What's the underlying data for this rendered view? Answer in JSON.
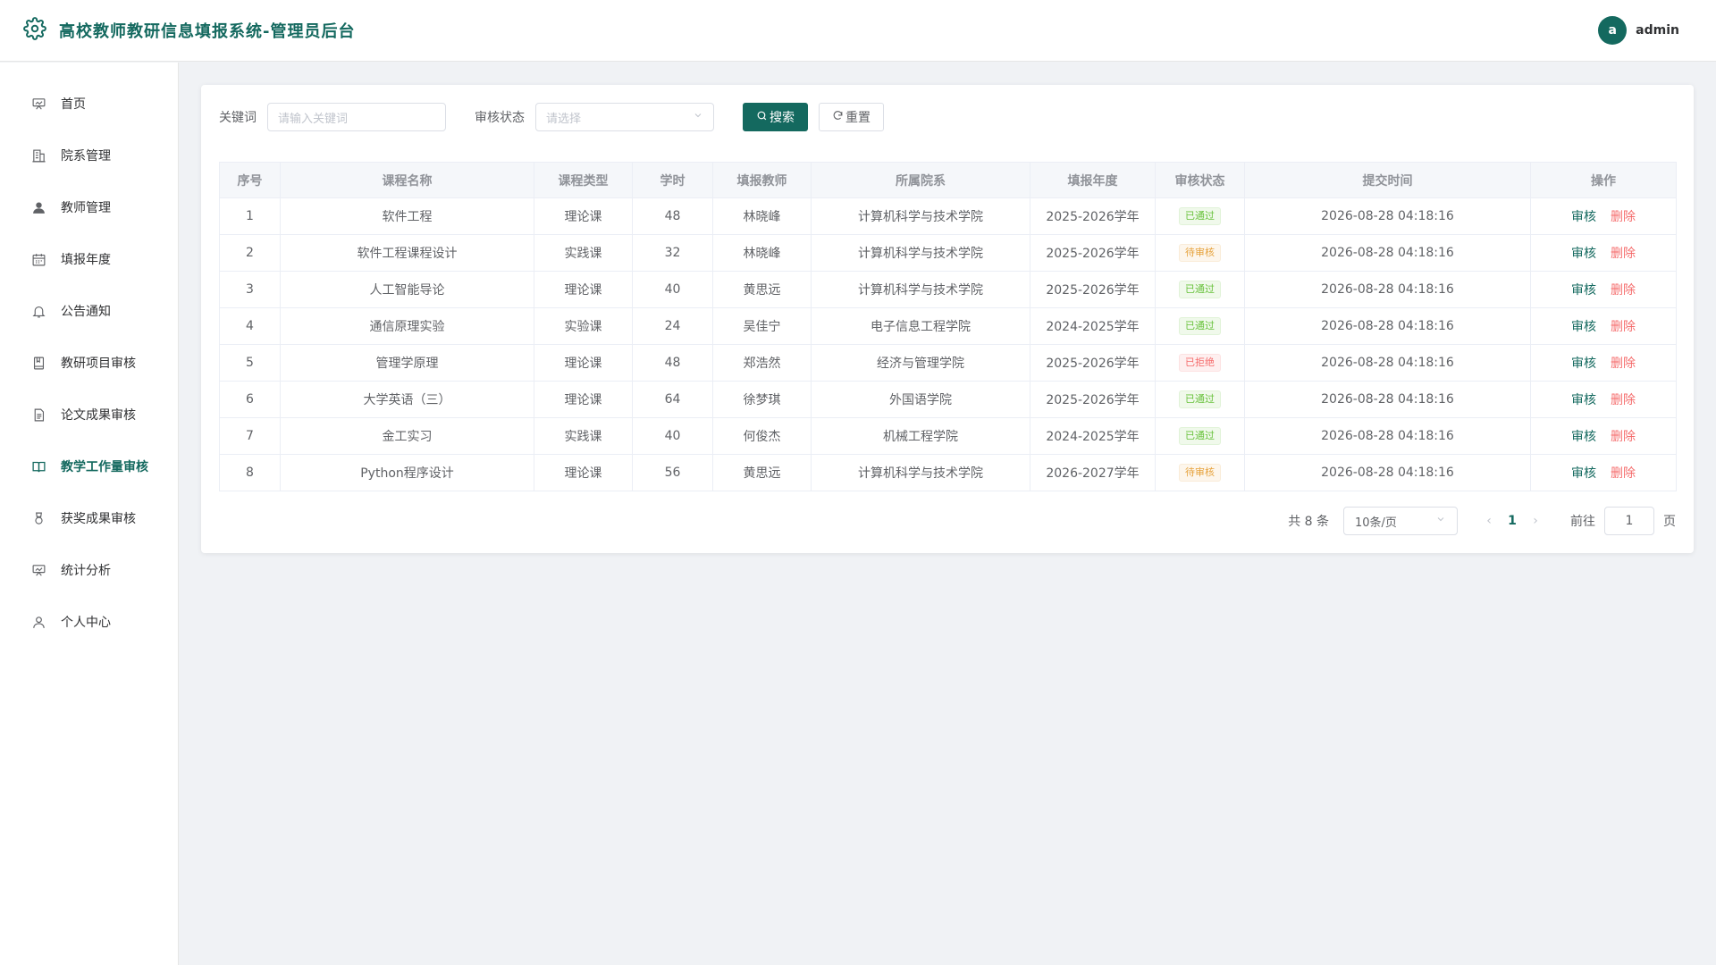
{
  "header": {
    "title": "高校教师教研信息填报系统-管理员后台",
    "avatar_letter": "a",
    "username": "admin",
    "accent": "#14695f"
  },
  "sidebar": {
    "items": [
      {
        "label": "首页",
        "icon": "home-icon"
      },
      {
        "label": "院系管理",
        "icon": "building-icon"
      },
      {
        "label": "教师管理",
        "icon": "user-icon"
      },
      {
        "label": "填报年度",
        "icon": "calendar-icon"
      },
      {
        "label": "公告通知",
        "icon": "bell-icon"
      },
      {
        "label": "教研项目审核",
        "icon": "notebook-icon"
      },
      {
        "label": "论文成果审核",
        "icon": "document-icon"
      },
      {
        "label": "教学工作量审核",
        "icon": "book-icon",
        "active": true
      },
      {
        "label": "获奖成果审核",
        "icon": "medal-icon"
      },
      {
        "label": "统计分析",
        "icon": "chart-icon"
      },
      {
        "label": "个人中心",
        "icon": "person-icon"
      }
    ]
  },
  "filter": {
    "keyword_label": "关键词",
    "keyword_placeholder": "请输入关键词",
    "status_label": "审核状态",
    "status_placeholder": "请选择",
    "search_label": "搜索",
    "reset_label": "重置"
  },
  "table": {
    "columns": [
      "序号",
      "课程名称",
      "课程类型",
      "学时",
      "填报教师",
      "所属院系",
      "填报年度",
      "审核状态",
      "提交时间",
      "操作"
    ],
    "rows": [
      {
        "no": "1",
        "course": "软件工程",
        "type": "理论课",
        "hours": "48",
        "teacher": "林晓峰",
        "dept": "计算机科学与技术学院",
        "year": "2025-2026学年",
        "status": "已通过",
        "status_type": "success",
        "time": "2026-08-28 04:18:16"
      },
      {
        "no": "2",
        "course": "软件工程课程设计",
        "type": "实践课",
        "hours": "32",
        "teacher": "林晓峰",
        "dept": "计算机科学与技术学院",
        "year": "2025-2026学年",
        "status": "待审核",
        "status_type": "warning",
        "time": "2026-08-28 04:18:16"
      },
      {
        "no": "3",
        "course": "人工智能导论",
        "type": "理论课",
        "hours": "40",
        "teacher": "黄思远",
        "dept": "计算机科学与技术学院",
        "year": "2025-2026学年",
        "status": "已通过",
        "status_type": "success",
        "time": "2026-08-28 04:18:16"
      },
      {
        "no": "4",
        "course": "通信原理实验",
        "type": "实验课",
        "hours": "24",
        "teacher": "吴佳宁",
        "dept": "电子信息工程学院",
        "year": "2024-2025学年",
        "status": "已通过",
        "status_type": "success",
        "time": "2026-08-28 04:18:16"
      },
      {
        "no": "5",
        "course": "管理学原理",
        "type": "理论课",
        "hours": "48",
        "teacher": "郑浩然",
        "dept": "经济与管理学院",
        "year": "2025-2026学年",
        "status": "已拒绝",
        "status_type": "danger",
        "time": "2026-08-28 04:18:16"
      },
      {
        "no": "6",
        "course": "大学英语（三）",
        "type": "理论课",
        "hours": "64",
        "teacher": "徐梦琪",
        "dept": "外国语学院",
        "year": "2025-2026学年",
        "status": "已通过",
        "status_type": "success",
        "time": "2026-08-28 04:18:16"
      },
      {
        "no": "7",
        "course": "金工实习",
        "type": "实践课",
        "hours": "40",
        "teacher": "何俊杰",
        "dept": "机械工程学院",
        "year": "2024-2025学年",
        "status": "已通过",
        "status_type": "success",
        "time": "2026-08-28 04:18:16"
      },
      {
        "no": "8",
        "course": "Python程序设计",
        "type": "理论课",
        "hours": "56",
        "teacher": "黄思远",
        "dept": "计算机科学与技术学院",
        "year": "2026-2027学年",
        "status": "待审核",
        "status_type": "warning",
        "time": "2026-08-28 04:18:16"
      }
    ],
    "action_review": "审核",
    "action_delete": "删除"
  },
  "pagination": {
    "total_text": "共 8 条",
    "page_size": "10条/页",
    "current_page": "1",
    "goto_label": "前往",
    "goto_value": "1",
    "page_suffix": "页"
  }
}
